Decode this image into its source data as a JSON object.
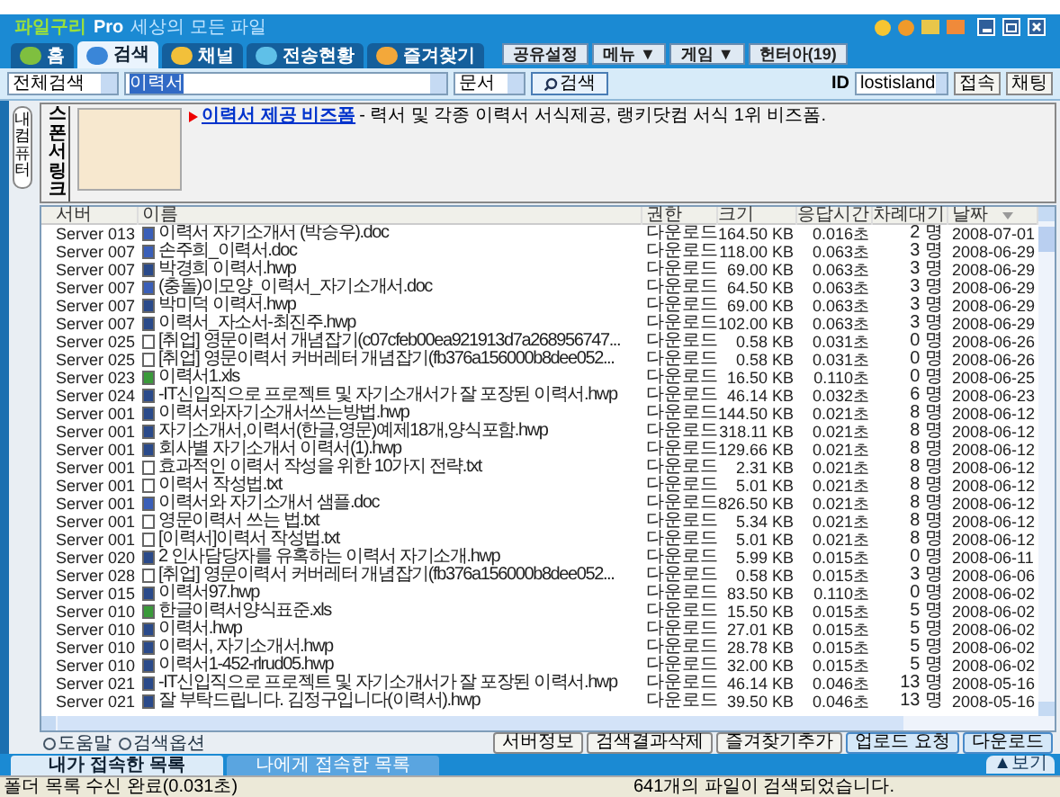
{
  "app": {
    "logo": "파일구리",
    "edition": "Pro",
    "tagline": "세상의 모든 파일"
  },
  "tabs": [
    {
      "label": "홈",
      "selected": false
    },
    {
      "label": "검색",
      "selected": true
    },
    {
      "label": "채널",
      "selected": false
    },
    {
      "label": "전송현황",
      "selected": false
    },
    {
      "label": "즐겨찾기",
      "selected": false
    }
  ],
  "top_buttons": [
    "공유설정",
    "메뉴 ▼",
    "게임 ▼",
    "헌터아(19)"
  ],
  "search": {
    "scope": "전체검색",
    "query": "이력서",
    "type": "문서",
    "button": "검색",
    "id_label": "ID",
    "id_value": "lostisland",
    "connect": "접속",
    "chat": "채팅"
  },
  "side_tab": "내컴퓨터",
  "sponsor": {
    "label": "스폰서링크",
    "link": "이력서 제공 비즈폼",
    "text": "- 력서 및 각종 이력서 서식제공, 랭키닷컴 서식 1위 비즈폼."
  },
  "table": {
    "columns": [
      "서버",
      "이름",
      "권한",
      "크기",
      "응답시간",
      "차례대기",
      "날짜"
    ],
    "rows": [
      {
        "kind": "doc",
        "cells": [
          "Server 013",
          "이력서 자기소개서 (박승우).doc",
          "다운로드",
          "164.50 KB",
          "0.016초",
          "2 명",
          "2008-07-01"
        ]
      },
      {
        "kind": "doc",
        "cells": [
          "Server 007",
          "손주희_이력서.doc",
          "다운로드",
          "118.00 KB",
          "0.063초",
          "3 명",
          "2008-06-29"
        ]
      },
      {
        "kind": "hwp",
        "cells": [
          "Server 007",
          "박경희 이력서.hwp",
          "다운로드",
          "69.00 KB",
          "0.063초",
          "3 명",
          "2008-06-29"
        ]
      },
      {
        "kind": "doc",
        "cells": [
          "Server 007",
          "(충돌)이모양_이력서_자기소개서.doc",
          "다운로드",
          "64.50 KB",
          "0.063초",
          "3 명",
          "2008-06-29"
        ]
      },
      {
        "kind": "hwp",
        "cells": [
          "Server 007",
          "박미덕 이력서.hwp",
          "다운로드",
          "69.00 KB",
          "0.063초",
          "3 명",
          "2008-06-29"
        ]
      },
      {
        "kind": "hwp",
        "cells": [
          "Server 007",
          "이력서_자소서-최진주.hwp",
          "다운로드",
          "102.00 KB",
          "0.063초",
          "3 명",
          "2008-06-29"
        ]
      },
      {
        "kind": "txt",
        "cells": [
          "Server 025",
          "[취업] 영문이력서 개념잡기(c07cfeb00ea921913d7a268956747...",
          "다운로드",
          "0.58 KB",
          "0.031초",
          "0 명",
          "2008-06-26"
        ]
      },
      {
        "kind": "txt",
        "cells": [
          "Server 025",
          "[취업] 영문이력서 커버레터 개념잡기(fb376a156000b8dee052...",
          "다운로드",
          "0.58 KB",
          "0.031초",
          "0 명",
          "2008-06-26"
        ]
      },
      {
        "kind": "xls",
        "cells": [
          "Server 023",
          "이력서1.xls",
          "다운로드",
          "16.50 KB",
          "0.110초",
          "0 명",
          "2008-06-25"
        ]
      },
      {
        "kind": "hwp",
        "cells": [
          "Server 024",
          "-IT신입직으로 프로젝트 및 자기소개서가 잘 포장된 이력서.hwp",
          "다운로드",
          "46.14 KB",
          "0.032초",
          "6 명",
          "2008-06-23"
        ]
      },
      {
        "kind": "hwp",
        "cells": [
          "Server 001",
          "이력서와자기소개서쓰는방법.hwp",
          "다운로드",
          "144.50 KB",
          "0.021초",
          "8 명",
          "2008-06-12"
        ]
      },
      {
        "kind": "hwp",
        "cells": [
          "Server 001",
          "자기소개서,이력서(한글,영문)예제18개,양식포함.hwp",
          "다운로드",
          "318.11 KB",
          "0.021초",
          "8 명",
          "2008-06-12"
        ]
      },
      {
        "kind": "hwp",
        "cells": [
          "Server 001",
          "회사별 자기소개서 이력서(1).hwp",
          "다운로드",
          "129.66 KB",
          "0.021초",
          "8 명",
          "2008-06-12"
        ]
      },
      {
        "kind": "txt",
        "cells": [
          "Server 001",
          "효과적인 이력서 작성을 위한 10가지 전략.txt",
          "다운로드",
          "2.31 KB",
          "0.021초",
          "8 명",
          "2008-06-12"
        ]
      },
      {
        "kind": "txt",
        "cells": [
          "Server 001",
          "이력서 작성법.txt",
          "다운로드",
          "5.01 KB",
          "0.021초",
          "8 명",
          "2008-06-12"
        ]
      },
      {
        "kind": "doc",
        "cells": [
          "Server 001",
          "이력서와 자기소개서 샘플.doc",
          "다운로드",
          "826.50 KB",
          "0.021초",
          "8 명",
          "2008-06-12"
        ]
      },
      {
        "kind": "txt",
        "cells": [
          "Server 001",
          "영문이력서 쓰는 법.txt",
          "다운로드",
          "5.34 KB",
          "0.021초",
          "8 명",
          "2008-06-12"
        ]
      },
      {
        "kind": "txt",
        "cells": [
          "Server 001",
          "[이력서]이력서 작성법.txt",
          "다운로드",
          "5.01 KB",
          "0.021초",
          "8 명",
          "2008-06-12"
        ]
      },
      {
        "kind": "hwp",
        "cells": [
          "Server 020",
          "2 인사담당자를 유혹하는 이력서 자기소개.hwp",
          "다운로드",
          "5.99 KB",
          "0.015초",
          "0 명",
          "2008-06-11"
        ]
      },
      {
        "kind": "txt",
        "cells": [
          "Server 028",
          "[취업] 영문이력서 커버레터 개념잡기(fb376a156000b8dee052...",
          "다운로드",
          "0.58 KB",
          "0.015초",
          "3 명",
          "2008-06-06"
        ]
      },
      {
        "kind": "hwp",
        "cells": [
          "Server 015",
          "이력서97.hwp",
          "다운로드",
          "83.50 KB",
          "0.110초",
          "0 명",
          "2008-06-02"
        ]
      },
      {
        "kind": "xls",
        "cells": [
          "Server 010",
          "한글이력서양식표준.xls",
          "다운로드",
          "15.50 KB",
          "0.015초",
          "5 명",
          "2008-06-02"
        ]
      },
      {
        "kind": "hwp",
        "cells": [
          "Server 010",
          "이력서.hwp",
          "다운로드",
          "27.01 KB",
          "0.015초",
          "5 명",
          "2008-06-02"
        ]
      },
      {
        "kind": "hwp",
        "cells": [
          "Server 010",
          "이력서, 자기소개서.hwp",
          "다운로드",
          "28.78 KB",
          "0.015초",
          "5 명",
          "2008-06-02"
        ]
      },
      {
        "kind": "hwp",
        "cells": [
          "Server 010",
          "이력서1-452-rlrud05.hwp",
          "다운로드",
          "32.00 KB",
          "0.015초",
          "5 명",
          "2008-06-02"
        ]
      },
      {
        "kind": "hwp",
        "cells": [
          "Server 021",
          "-IT신입직으로 프로젝트 및 자기소개서가 잘 포장된 이력서.hwp",
          "다운로드",
          "46.14 KB",
          "0.046초",
          "13 명",
          "2008-05-16"
        ]
      },
      {
        "kind": "hwp",
        "cells": [
          "Server 021",
          "잘 부탁드립니다. 김정구입니다(이력서).hwp",
          "다운로드",
          "39.50 KB",
          "0.046초",
          "13 명",
          "2008-05-16"
        ]
      }
    ]
  },
  "links": [
    "도움말",
    "검색옵션"
  ],
  "actions": [
    "서버정보",
    "검색결과삭제",
    "즐겨찾기추가",
    "업로드 요청",
    "다운로드"
  ],
  "bottom_tabs": [
    {
      "label": "내가 접속한 목록",
      "selected": true
    },
    {
      "label": "나에게 접속한 목록",
      "selected": false
    }
  ],
  "view_button": "▲보기",
  "status": {
    "left": "폴더 목록 수신 완료(0.031초)",
    "right": "641개의 파일이 검색되었습니다."
  }
}
